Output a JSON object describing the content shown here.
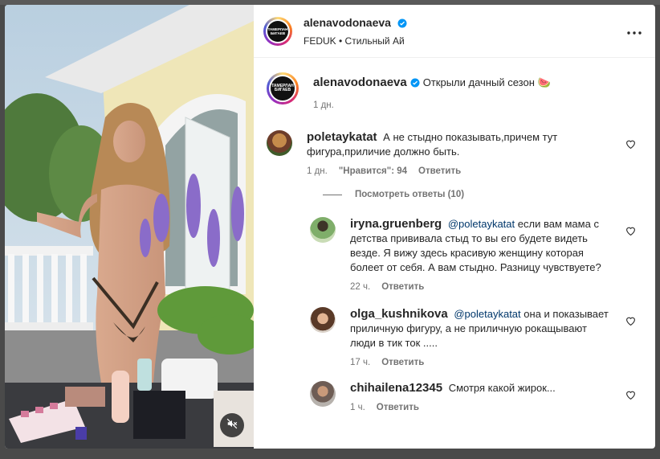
{
  "post": {
    "author": "alenavodonaeva",
    "audio": "FEDUK • Стильный Ай",
    "avatar_text_line1": "ТАМЕРЛАН",
    "avatar_text_line2": "БИГАЕВ",
    "caption": "Открыли дачный сезон 🍉",
    "caption_time": "1 дн."
  },
  "comments": [
    {
      "username": "poletaykatat",
      "text": "А не стыдно показывать,причем тут фигура,приличие должно быть.",
      "time": "1 дн.",
      "likes": "\"Нравится\": 94",
      "reply_label": "Ответить",
      "view_replies": "Посмотреть ответы (10)"
    }
  ],
  "replies": [
    {
      "username": "iryna.gruenberg",
      "mention": "@poletaykatat",
      "text": "если вам мама с детства прививала стыд то вы его будете видеть везде. Я вижу здесь красивую женщину которая болеет от себя. А вам стыдно. Разницу чувствуете?",
      "time": "22 ч.",
      "reply_label": "Ответить"
    },
    {
      "username": "olga_kushnikova",
      "mention": "@poletaykatat",
      "text": "она и показывает приличную фигуру, а не приличную рокащывают люди в тик ток .....",
      "time": "17 ч.",
      "reply_label": "Ответить"
    },
    {
      "username": "chihailena12345",
      "mention": "",
      "text": "Смотря какой жирок...",
      "time": "1 ч.",
      "reply_label": "Ответить"
    }
  ],
  "icons": {
    "verified": "verified-badge-icon",
    "more": "more-options-icon",
    "heart": "heart-outline-icon",
    "mute": "muted-speaker-icon"
  },
  "colors": {
    "verified": "#0095f6",
    "secondary_text": "#737373",
    "mention": "#00376b"
  }
}
